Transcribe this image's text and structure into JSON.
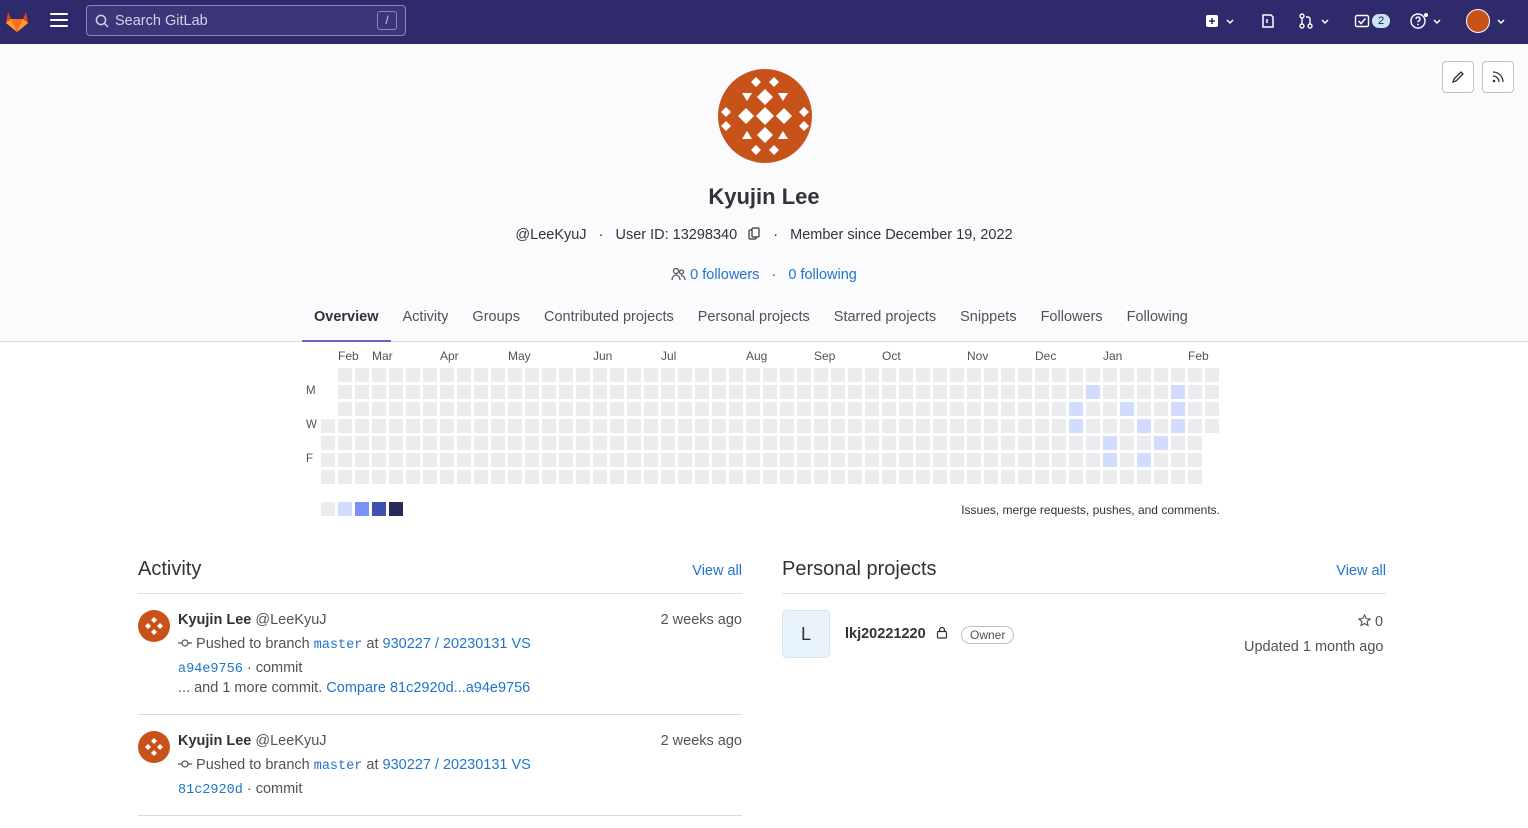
{
  "nav": {
    "search_placeholder": "Search GitLab",
    "search_shortcut": "/",
    "todo_count": "2"
  },
  "profile": {
    "name": "Kyujin Lee",
    "username": "@LeeKyuJ",
    "user_id": "User ID: 13298340",
    "member_since": "Member since December 19, 2022",
    "followers": "0 followers",
    "following": "0 following"
  },
  "tabs": [
    "Overview",
    "Activity",
    "Groups",
    "Contributed projects",
    "Personal projects",
    "Starred projects",
    "Snippets",
    "Followers",
    "Following"
  ],
  "calendar": {
    "months": [
      "Feb",
      "Mar",
      "Apr",
      "May",
      "Jun",
      "Jul",
      "Aug",
      "Sep",
      "Oct",
      "Nov",
      "Dec",
      "Jan",
      "Feb"
    ],
    "day_labels": [
      "M",
      "W",
      "F"
    ],
    "note": "Issues, merge requests, pushes, and comments.",
    "legend_colors": [
      "#ececef",
      "#d2dcff",
      "#7992f5",
      "#3f51ae",
      "#2a2b59"
    ],
    "active_cells": [
      {
        "week": 45,
        "day": 1
      },
      {
        "week": 50,
        "day": 1
      },
      {
        "week": 44,
        "day": 2
      },
      {
        "week": 47,
        "day": 2
      },
      {
        "week": 50,
        "day": 2
      },
      {
        "week": 44,
        "day": 3
      },
      {
        "week": 48,
        "day": 3
      },
      {
        "week": 50,
        "day": 3
      },
      {
        "week": 46,
        "day": 4
      },
      {
        "week": 49,
        "day": 4
      },
      {
        "week": 46,
        "day": 5
      },
      {
        "week": 48,
        "day": 5
      }
    ]
  },
  "activity": {
    "title": "Activity",
    "view_all": "View all",
    "items": [
      {
        "author": "Kyujin Lee",
        "handle": "@LeeKyuJ",
        "time": "2 weeks ago",
        "action": "Pushed to branch",
        "branch": "master",
        "at": "at",
        "project": "930227 / 20230131 VS",
        "commit": "a94e9756",
        "commit_suffix": "· commit",
        "more": "... and 1 more commit.",
        "compare": "Compare 81c2920d...a94e9756"
      },
      {
        "author": "Kyujin Lee",
        "handle": "@LeeKyuJ",
        "time": "2 weeks ago",
        "action": "Pushed to branch",
        "branch": "master",
        "at": "at",
        "project": "930227 / 20230131 VS",
        "commit": "81c2920d",
        "commit_suffix": "· commit"
      }
    ]
  },
  "projects": {
    "title": "Personal projects",
    "view_all": "View all",
    "items": [
      {
        "initial": "L",
        "name": "lkj20221220",
        "role": "Owner",
        "stars": "0",
        "updated": "Updated 1 month ago"
      }
    ]
  }
}
